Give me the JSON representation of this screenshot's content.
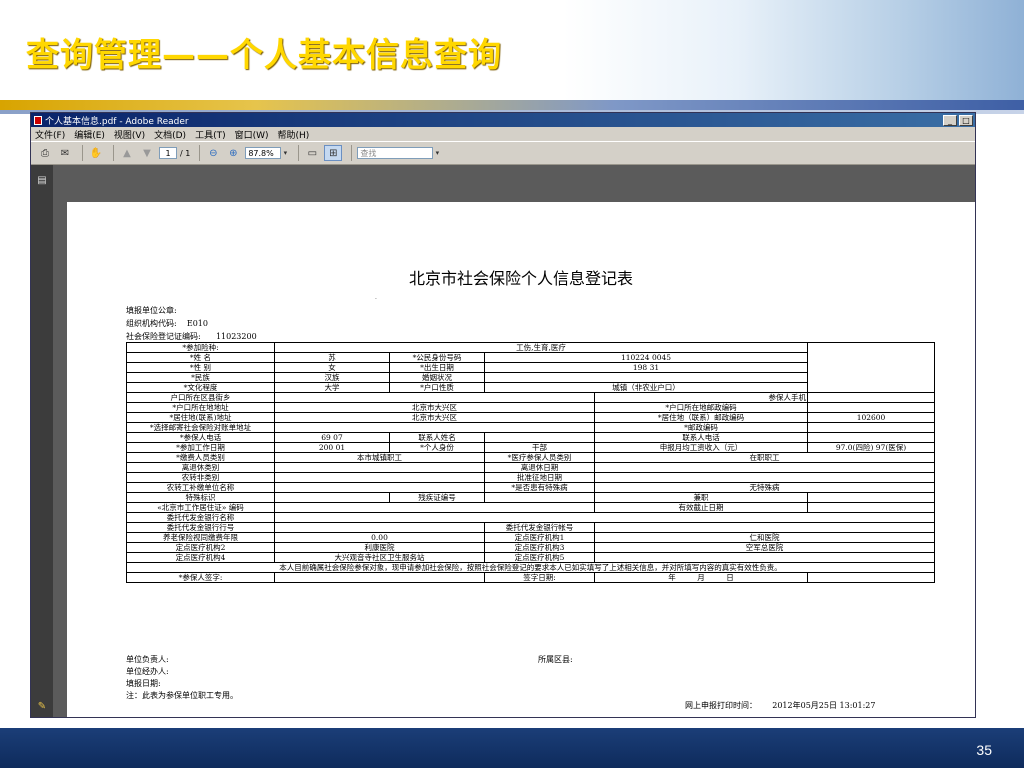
{
  "slide": {
    "title": "查询管理——个人基本信息查询",
    "page_number": "35"
  },
  "window": {
    "title": "个人基本信息.pdf - Adobe Reader",
    "controls": [
      "_",
      "□"
    ],
    "menu": [
      "文件(F)",
      "编辑(E)",
      "视图(V)",
      "文档(D)",
      "工具(T)",
      "窗口(W)",
      "帮助(H)"
    ],
    "toolbar": {
      "page_current": "1",
      "page_total": "/ 1",
      "zoom": "87.8%",
      "search_placeholder": "查找"
    }
  },
  "form": {
    "title": "北京市社会保险个人信息登记表",
    "dot": "·",
    "header": {
      "unit_seal": "填报单位公章:",
      "org_code": "组织机构代码:    E010",
      "reg_no": "社会保险登记证编码:      11023200"
    },
    "rows": {
      "r1": [
        "*参加险种:",
        "工伤,生育,医疗"
      ],
      "r2": [
        "*姓    名",
        "苏",
        "*公民身份号码",
        "110224              0045"
      ],
      "r3": [
        "*性    别",
        "女",
        "*出生日期",
        "198    31"
      ],
      "r4": [
        "*民族",
        "汉族",
        "婚姻状况",
        ""
      ],
      "r5": [
        "*文化程度",
        "大学",
        "*户口性质",
        "城镇（非农业户口）"
      ],
      "r6": [
        "户口所在区县街乡",
        "",
        "参保人手机",
        ""
      ],
      "r7": [
        "*户口所在地地址",
        "北京市大兴区",
        "*户口所在地邮政编码",
        ""
      ],
      "r8": [
        "*居住地(联系)地址",
        "北京市大兴区",
        "*居住地（联系）邮政编码",
        "102600"
      ],
      "r9": [
        "*选择邮寄社会保险对账单地址",
        "",
        "*邮政编码",
        ""
      ],
      "r10": [
        "*参保人电话",
        "69       07",
        "联系人姓名",
        "",
        "联系人电话",
        ""
      ],
      "r11": [
        "*参加工作日期",
        "200    01",
        "*个人身份",
        "干部",
        "申报月均工资收入（元）",
        "97.0(四险)    97(医保)"
      ],
      "r12": [
        "*缴费人员类别",
        "本市城镇职工",
        "*医疗参保人员类别",
        "在职职工"
      ],
      "r13": [
        "离退休类别",
        "",
        "离退休日期",
        ""
      ],
      "r14": [
        "农转非类别",
        "",
        "批准征地日期",
        ""
      ],
      "r15": [
        "农转工补缴单位名称",
        "",
        "*是否患有特殊病",
        "无特殊病"
      ],
      "r16": [
        "特殊标识",
        "",
        "残疾证编号",
        "",
        "兼职",
        ""
      ],
      "r17": [
        "«北京市工作居住证» 编码",
        "",
        "有效截止日期",
        ""
      ],
      "r18": [
        "委托代发金银行名称",
        ""
      ],
      "r19": [
        "委托代发金银行行号",
        "",
        "委托代发金银行帐号",
        ""
      ],
      "r20": [
        "养老保险视同缴费年限",
        "0.00",
        "定点医疗机构1",
        "仁和医院"
      ],
      "r21": [
        "定点医疗机构2",
        "利康医院",
        "定点医疗机构3",
        "空军总医院"
      ],
      "r22": [
        "定点医疗机构4",
        "大兴观音寺社区卫生服务站",
        "定点医疗机构5",
        ""
      ],
      "r23": [
        "本人目前确属社会保险参保对象，现申请参加社会保险，按照社会保险登记的要求本人已如实填写了上述相关信息，并对所填写内容的真实有效性负责。"
      ],
      "r24": [
        "*参保人签字:",
        "签字日期:",
        "年",
        "月",
        "日"
      ]
    },
    "footer": {
      "unit_head": "单位负责人:",
      "district": "所属区县:",
      "handler": "单位经办人:",
      "fill_date": "填报日期:",
      "note": "注：此表为参保单位职工专用。",
      "print_time": "网上申报打印时间：      2012年05月25日 13:01:27"
    }
  }
}
